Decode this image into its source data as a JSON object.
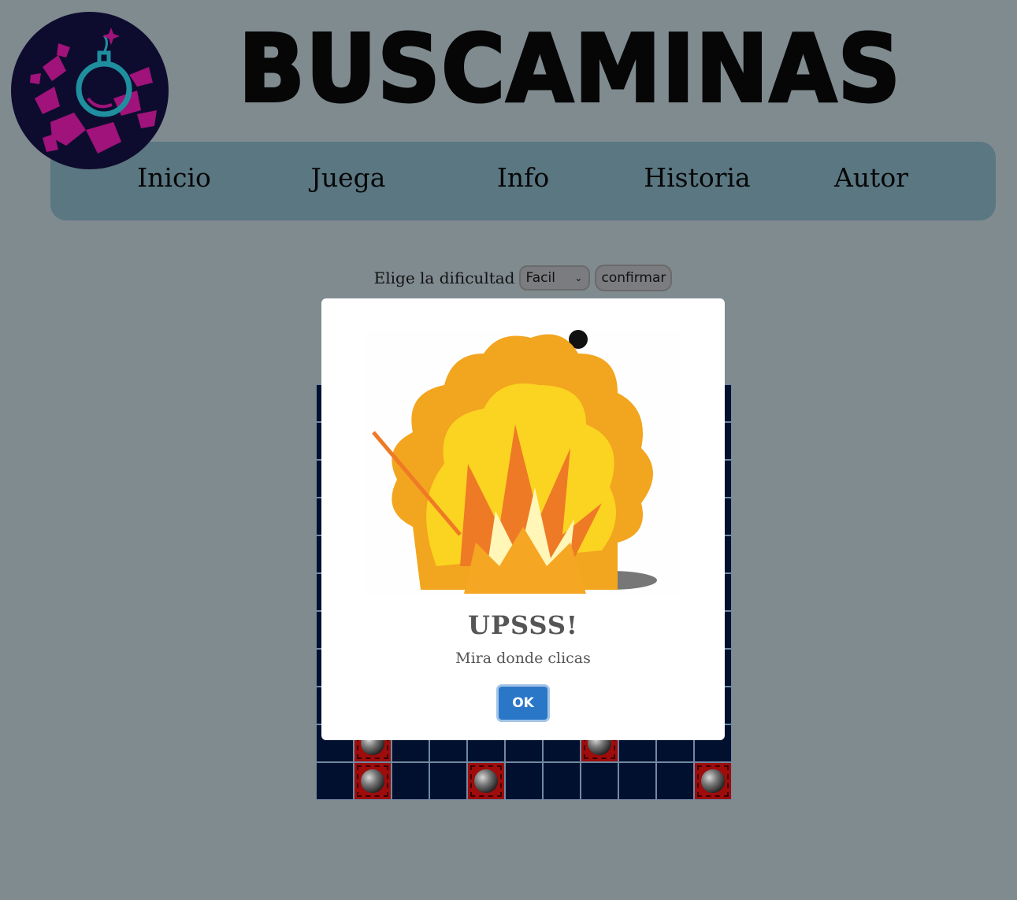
{
  "header": {
    "title": "BUSCAMINAS",
    "logo_icon": "bomb-logo-icon"
  },
  "nav": {
    "items": [
      {
        "label": "Inicio"
      },
      {
        "label": "Juega"
      },
      {
        "label": "Info"
      },
      {
        "label": "Historia"
      },
      {
        "label": "Autor"
      }
    ]
  },
  "difficulty": {
    "label": "Elige la dificultad",
    "selected": "Facil",
    "confirm_label": "confirmar"
  },
  "board": {
    "columns": 11,
    "rows": 11,
    "mine_icon": "mine-icon",
    "revealed_mines": [
      {
        "row": 10,
        "col": 2
      },
      {
        "row": 10,
        "col": 8
      },
      {
        "row": 11,
        "col": 2
      },
      {
        "row": 11,
        "col": 5
      },
      {
        "row": 11,
        "col": 11
      }
    ]
  },
  "modal": {
    "image_icon": "explosion-icon",
    "title": "UPSSS!",
    "text": "Mira donde clicas",
    "ok_label": "OK"
  },
  "colors": {
    "page_bg": "#808b90",
    "nav_bg": "#5a7782",
    "cell_bg": "#021030",
    "mine_bg": "#9e0c0c",
    "ok_button": "#2a77c8"
  }
}
